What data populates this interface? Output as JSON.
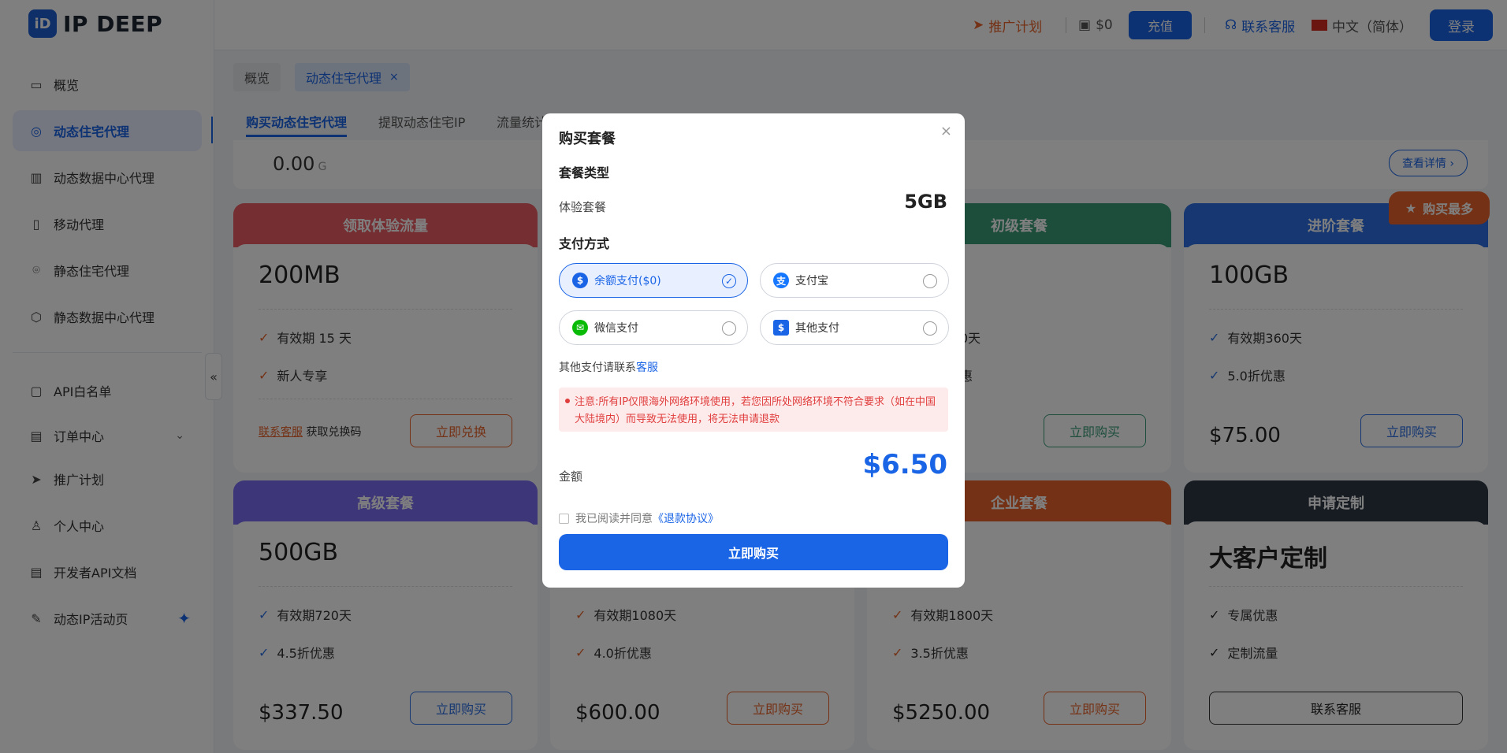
{
  "brand": {
    "logo_glyph": "iD",
    "name": "IP DEEP"
  },
  "sidebar": {
    "items": [
      {
        "label": "概览"
      },
      {
        "label": "动态住宅代理"
      },
      {
        "label": "动态数据中心代理"
      },
      {
        "label": "移动代理"
      },
      {
        "label": "静态住宅代理"
      },
      {
        "label": "静态数据中心代理"
      },
      {
        "label": "API白名单"
      },
      {
        "label": "订单中心"
      },
      {
        "label": "推广计划"
      },
      {
        "label": "个人中心"
      },
      {
        "label": "开发者API文档"
      },
      {
        "label": "动态IP活动页"
      }
    ],
    "collapse_glyph": "«"
  },
  "header": {
    "promo": "推广计划",
    "balance": "$0",
    "recharge": "充值",
    "support": "联系客服",
    "language": "中文（简体）",
    "login": "登录"
  },
  "tabs": {
    "overview": "概览",
    "current": "动态住宅代理",
    "close": "×"
  },
  "subtabs": [
    "购买动态住宅代理",
    "提取动态住宅IP",
    "流量统计"
  ],
  "usage": {
    "value": "0.00",
    "unit": "G",
    "detail": "查看详情 ›"
  },
  "badge": "购买最多",
  "cards": {
    "trial": {
      "title": "领取体验流量",
      "name": "200MB",
      "f1": "有效期 15 天",
      "f2": "新人专享",
      "link": "联系客服",
      "text": "获取兑换码",
      "btn": "立即兑换"
    },
    "basic": {
      "title": "初级套餐",
      "f1": "0天",
      "f2": "惠",
      "btn": "立即购买"
    },
    "advanced": {
      "title": "进阶套餐",
      "name": "100GB",
      "f1": "有效期360天",
      "f2": "5.0折优惠",
      "price": "$75.00",
      "btn": "立即购买"
    },
    "senior": {
      "title": "高级套餐",
      "name": "500GB",
      "f1": "有效期720天",
      "f2": "4.5折优惠",
      "price": "$337.50",
      "btn": "立即购买"
    },
    "mid": {
      "f1": "有效期1080天",
      "f2": "4.0折优惠",
      "price": "$600.00",
      "btn": "立即购买"
    },
    "enterprise": {
      "title": "企业套餐",
      "f1": "有效期1800天",
      "f2": "3.5折优惠",
      "price": "$5250.00",
      "btn": "立即购买"
    },
    "custom": {
      "title": "申请定制",
      "name": "大客户定制",
      "f1": "专属优惠",
      "f2": "定制流量",
      "btn": "联系客服"
    }
  },
  "modal": {
    "title": "购买套餐",
    "close": "×",
    "type_label": "套餐类型",
    "plan": "体验套餐",
    "size": "5GB",
    "pay_label": "支付方式",
    "pay": [
      {
        "label": "余额支付($0)",
        "selected": true
      },
      {
        "label": "支付宝"
      },
      {
        "label": "微信支付"
      },
      {
        "label": "其他支付"
      }
    ],
    "other_hint": "其他支付请联系",
    "other_link": "客服",
    "notice": "注意:所有IP仅限海外网络环境使用，若您因所处网络环境不符合要求（如在中国大陆境内）而导致无法使用，将无法申请退款",
    "amount_label": "金额",
    "amount": "$6.50",
    "agree": "我已阅读并同意",
    "agree_link": "《退款协议》",
    "buy": "立即购买"
  }
}
